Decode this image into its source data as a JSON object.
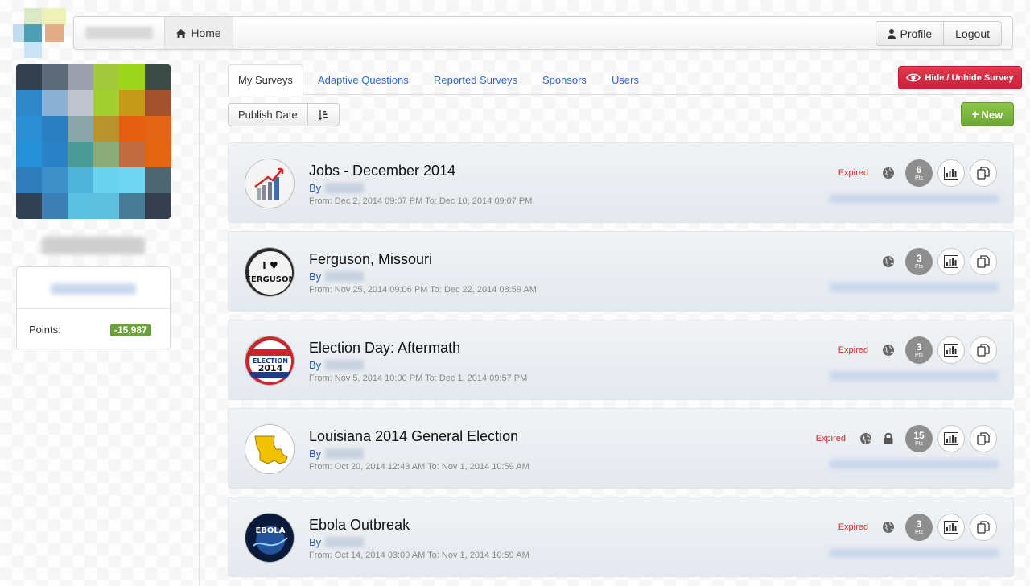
{
  "navbar": {
    "home_label": "Home",
    "profile_label": "Profile",
    "logout_label": "Logout"
  },
  "sidebar": {
    "points_label": "Points:",
    "points_value": "-15,987"
  },
  "tabs": [
    {
      "label": "My Surveys",
      "active": true
    },
    {
      "label": "Adaptive Questions",
      "active": false
    },
    {
      "label": "Reported Surveys",
      "active": false
    },
    {
      "label": "Sponsors",
      "active": false
    },
    {
      "label": "Users",
      "active": false
    }
  ],
  "toolbar": {
    "hide_unhide_label": "Hide / Unhide Survey",
    "sort_label": "Publish Date",
    "new_label": "New"
  },
  "surveys": [
    {
      "title": "Jobs - December 2014",
      "by": "By",
      "dates": "From: Dec 2, 2014 09:07 PM To: Dec 10, 2014 09:07 PM",
      "status": "Expired",
      "points": "6",
      "pts_label": "Pts",
      "locked": false
    },
    {
      "title": "Ferguson, Missouri",
      "by": "By",
      "dates": "From: Nov 25, 2014 09:06 PM To: Dec 22, 2014 08:59 AM",
      "status": "",
      "points": "3",
      "pts_label": "Pts",
      "locked": false
    },
    {
      "title": "Election Day: Aftermath",
      "by": "By",
      "dates": "From: Nov 5, 2014 10:00 PM To: Dec 1, 2014 09:57 PM",
      "status": "Expired",
      "points": "3",
      "pts_label": "Pts",
      "locked": false
    },
    {
      "title": "Louisiana 2014 General Election",
      "by": "By",
      "dates": "From: Oct 20, 2014 12:43 AM To: Nov 1, 2014 10:59 AM",
      "status": "Expired",
      "points": "15",
      "pts_label": "Pts",
      "locked": true
    },
    {
      "title": "Ebola Outbreak",
      "by": "By",
      "dates": "From: Oct 14, 2014 03:09 AM To: Nov 1, 2014 10:59 AM",
      "status": "Expired",
      "points": "3",
      "pts_label": "Pts",
      "locked": false
    }
  ],
  "thumb_text": {
    "ferguson_heart": "I ♥",
    "ferguson_word": "FERGUSON",
    "election_word": "ELECTION",
    "election_year": "2014",
    "ebola_word": "EBOLA"
  }
}
